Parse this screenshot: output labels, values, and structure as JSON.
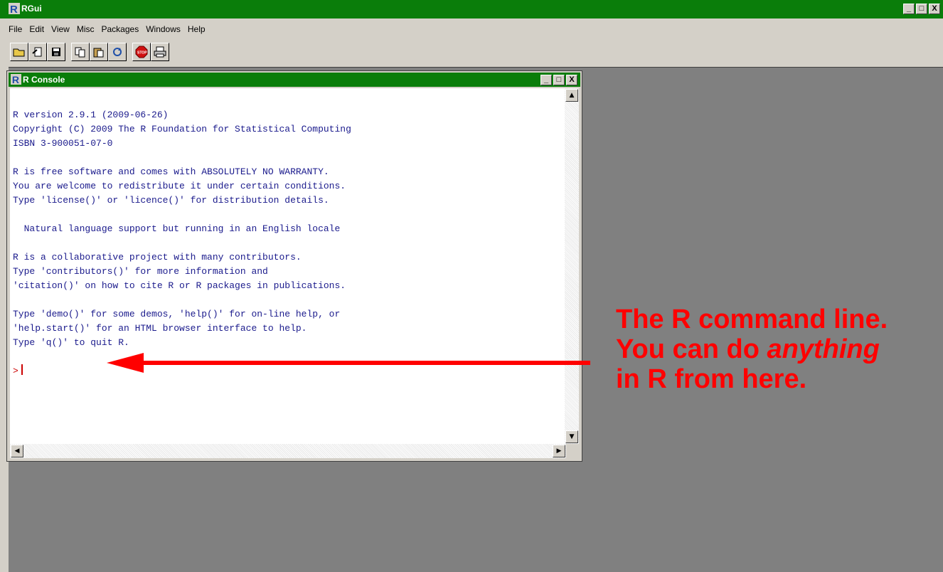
{
  "app": {
    "title": "RGui",
    "window_buttons": [
      "_",
      "□",
      "X"
    ]
  },
  "menu": [
    "File",
    "Edit",
    "View",
    "Misc",
    "Packages",
    "Windows",
    "Help"
  ],
  "toolbar": {
    "buttons": [
      "open-script",
      "load-workspace",
      "save-workspace",
      "copy",
      "paste",
      "copy-paste",
      "stop",
      "print"
    ]
  },
  "console": {
    "title": "R Console",
    "lines": [
      "R version 2.9.1 (2009-06-26)",
      "Copyright (C) 2009 The R Foundation for Statistical Computing",
      "ISBN 3-900051-07-0",
      "",
      "R is free software and comes with ABSOLUTELY NO WARRANTY.",
      "You are welcome to redistribute it under certain conditions.",
      "Type 'license()' or 'licence()' for distribution details.",
      "",
      "  Natural language support but running in an English locale",
      "",
      "R is a collaborative project with many contributors.",
      "Type 'contributors()' for more information and",
      "'citation()' on how to cite R or R packages in publications.",
      "",
      "Type 'demo()' for some demos, 'help()' for on-line help, or",
      "'help.start()' for an HTML browser interface to help.",
      "Type 'q()' to quit R.",
      ""
    ],
    "prompt": ">"
  },
  "annotation": {
    "line1": "The R command line.",
    "line2_pre": "You can do ",
    "line2_em": "anything",
    "line3": "in R from here.",
    "color": "#ff0000"
  }
}
